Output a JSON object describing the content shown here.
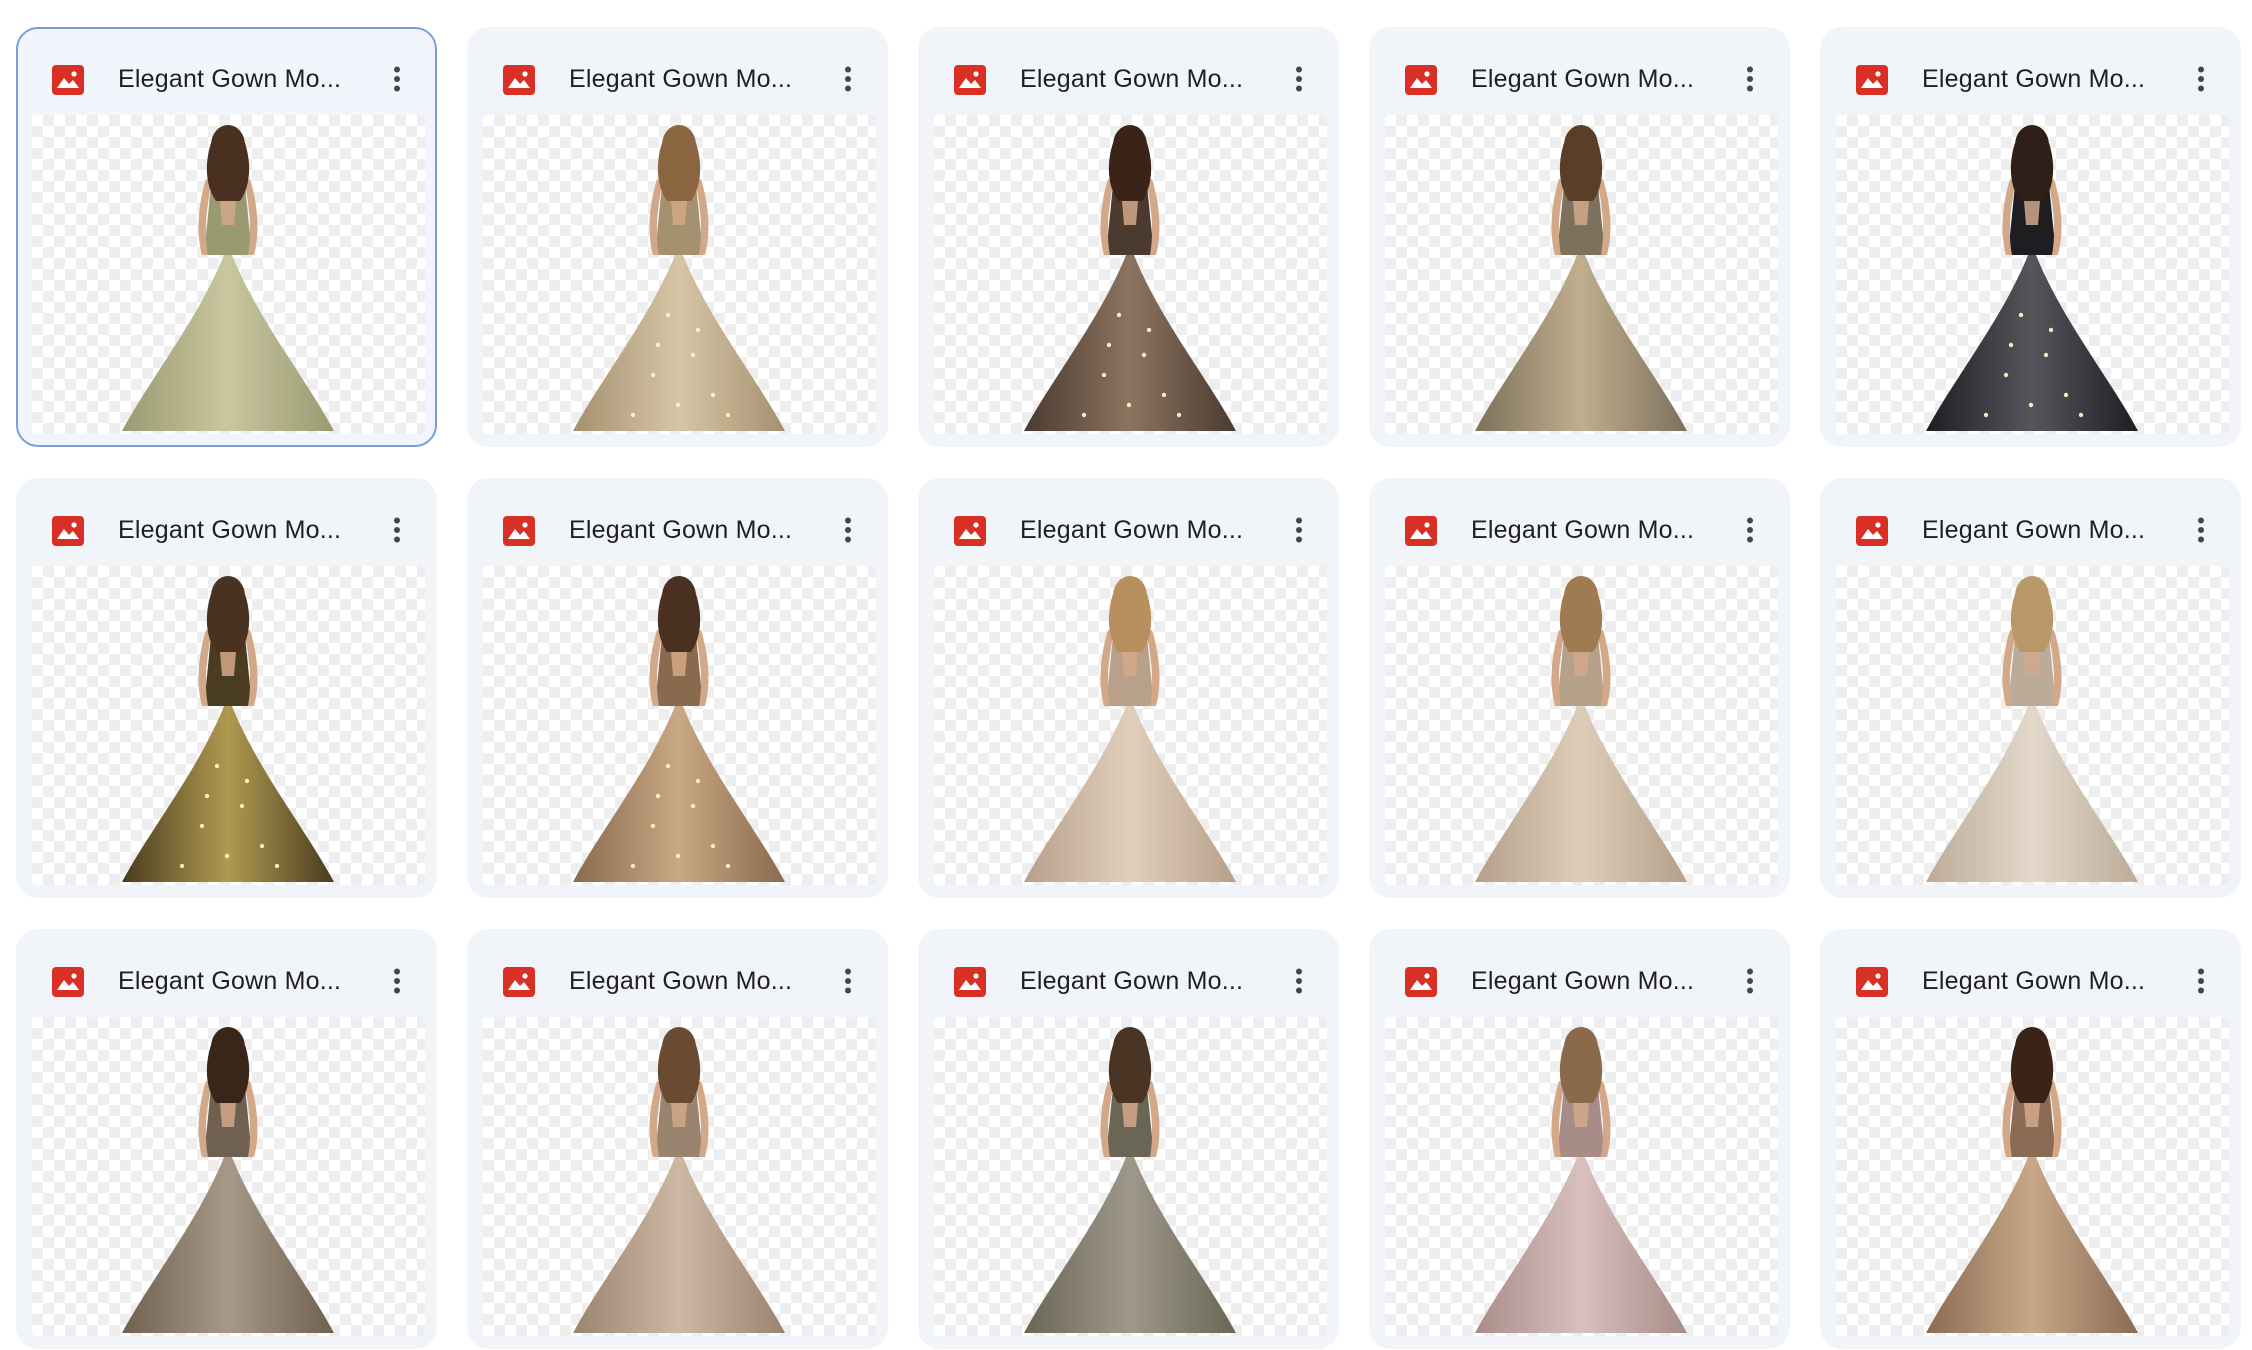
{
  "files": [
    {
      "name": "Elegant Gown Mo...",
      "selected": true,
      "hair": "#4a3020",
      "gown": "#9a9a72",
      "gown_light": "#c9c6a0",
      "sparkle": false
    },
    {
      "name": "Elegant Gown Mo...",
      "selected": false,
      "hair": "#8a6540",
      "gown": "#a5906f",
      "gown_light": "#d6c6a6",
      "sparkle": true
    },
    {
      "name": "Elegant Gown Mo...",
      "selected": false,
      "hair": "#3a2418",
      "gown": "#4a3a30",
      "gown_light": "#8c7460",
      "sparkle": true
    },
    {
      "name": "Elegant Gown Mo...",
      "selected": false,
      "hair": "#5a3e28",
      "gown": "#7d705c",
      "gown_light": "#c0ae8e",
      "sparkle": false
    },
    {
      "name": "Elegant Gown Mo...",
      "selected": false,
      "hair": "#2e2018",
      "gown": "#1e1e22",
      "gown_light": "#55555c",
      "sparkle": true
    },
    {
      "name": "Elegant Gown Mo...",
      "selected": false,
      "hair": "#4a3220",
      "gown": "#4a3c20",
      "gown_light": "#b09a50",
      "sparkle": true
    },
    {
      "name": "Elegant Gown Mo...",
      "selected": false,
      "hair": "#4a3020",
      "gown": "#8a6a4e",
      "gown_light": "#c9a884",
      "sparkle": true
    },
    {
      "name": "Elegant Gown Mo...",
      "selected": false,
      "hair": "#b89060",
      "gown": "#b8a08a",
      "gown_light": "#e0cfbc",
      "sparkle": false
    },
    {
      "name": "Elegant Gown Mo...",
      "selected": false,
      "hair": "#a07a50",
      "gown": "#b5a08a",
      "gown_light": "#ddcdb8",
      "sparkle": false
    },
    {
      "name": "Elegant Gown Mo...",
      "selected": false,
      "hair": "#b89868",
      "gown": "#bcab98",
      "gown_light": "#e3d8ca",
      "sparkle": false
    },
    {
      "name": "Elegant Gown Mo...",
      "selected": false,
      "hair": "#3a2618",
      "gown": "#706050",
      "gown_light": "#a89888",
      "sparkle": false
    },
    {
      "name": "Elegant Gown Mo...",
      "selected": false,
      "hair": "#6a4a30",
      "gown": "#9a8470",
      "gown_light": "#cdb8a4",
      "sparkle": false
    },
    {
      "name": "Elegant Gown Mo...",
      "selected": false,
      "hair": "#4a3424",
      "gown": "#6a6656",
      "gown_light": "#9e988a",
      "sparkle": false
    },
    {
      "name": "Elegant Gown Mo...",
      "selected": false,
      "hair": "#8a6a4a",
      "gown": "#a88c88",
      "gown_light": "#d8c0bc",
      "sparkle": false
    },
    {
      "name": "Elegant Gown Mo...",
      "selected": false,
      "hair": "#3a2418",
      "gown": "#8a6a52",
      "gown_light": "#c8a888",
      "sparkle": false
    }
  ],
  "icons": {
    "file_type": "image-file-icon",
    "more": "more-vert-icon"
  },
  "colors": {
    "file_icon": "#d93025",
    "selected_border": "#7a9fd9",
    "card_bg": "#f1f4f9"
  }
}
